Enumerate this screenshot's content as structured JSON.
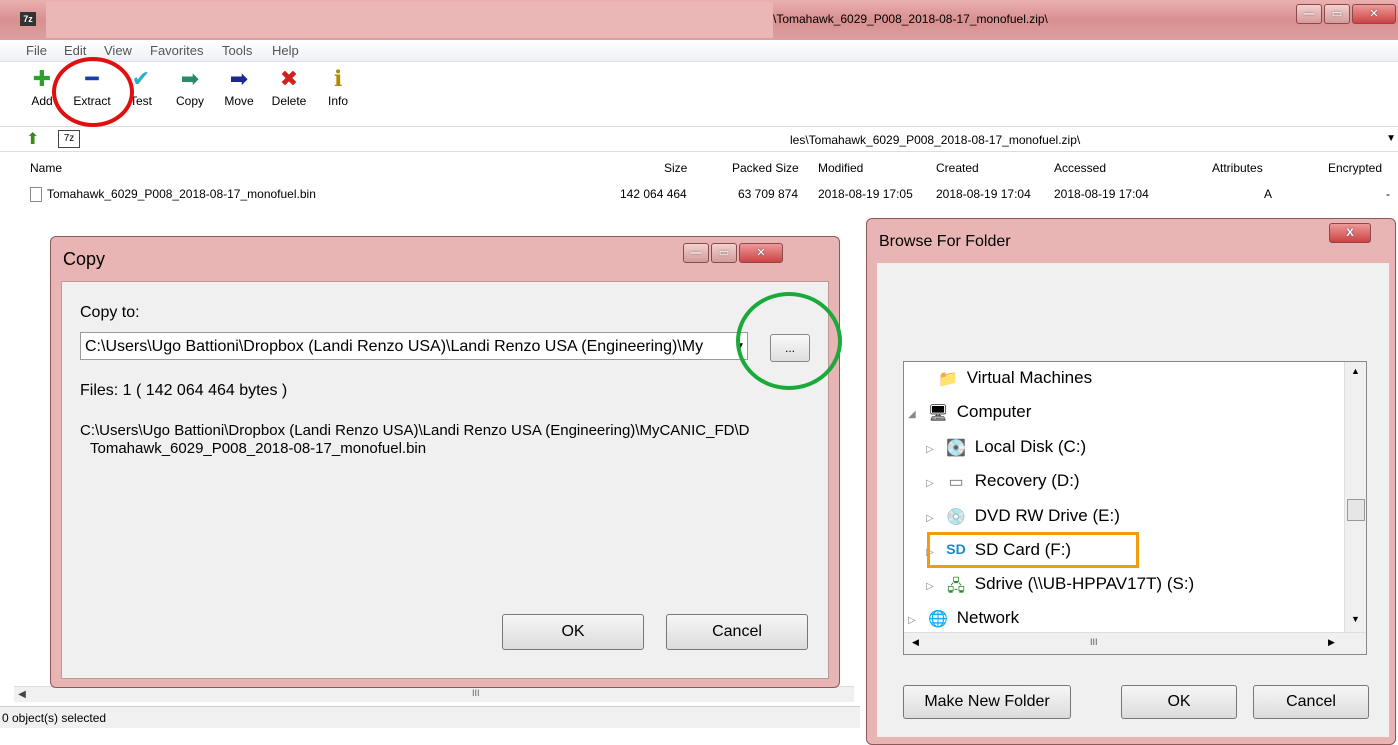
{
  "main": {
    "title_path": "\\Tomahawk_6029_P008_2018-08-17_monofuel.zip\\",
    "app_icon": "7z",
    "menu": [
      "File",
      "Edit",
      "View",
      "Favorites",
      "Tools",
      "Help"
    ],
    "toolbar": [
      {
        "label": "Add",
        "icon": "plus-icon",
        "glyph": "✚",
        "color": "#2ea02e"
      },
      {
        "label": "Extract",
        "icon": "minus-icon",
        "glyph": "━",
        "color": "#1a3fa8"
      },
      {
        "label": "Test",
        "icon": "check-icon",
        "glyph": "✔",
        "color": "#2aaec8"
      },
      {
        "label": "Copy",
        "icon": "copy-arrow-icon",
        "glyph": "➡",
        "color": "#2a8a6a"
      },
      {
        "label": "Move",
        "icon": "move-arrow-icon",
        "glyph": "➡",
        "color": "#1a2a8a"
      },
      {
        "label": "Delete",
        "icon": "delete-icon",
        "glyph": "✖",
        "color": "#d02020"
      },
      {
        "label": "Info",
        "icon": "info-icon",
        "glyph": "ℹ",
        "color": "#b08a00"
      }
    ],
    "address": "les\\Tomahawk_6029_P008_2018-08-17_monofuel.zip\\",
    "columns": [
      "Name",
      "Size",
      "Packed Size",
      "Modified",
      "Created",
      "Accessed",
      "Attributes",
      "Encrypted"
    ],
    "file": {
      "name": "Tomahawk_6029_P008_2018-08-17_monofuel.bin",
      "size": "142 064 464",
      "packed": "63 709 874",
      "modified": "2018-08-19 17:05",
      "created": "2018-08-19 17:04",
      "accessed": "2018-08-19 17:04",
      "attributes": "A",
      "encrypted": "-"
    },
    "status": "0 object(s) selected",
    "scroll_marker": "III"
  },
  "copy_dialog": {
    "title": "Copy",
    "copy_to_label": "Copy to:",
    "path_value": "C:\\Users\\Ugo Battioni\\Dropbox (Landi Renzo USA)\\Landi Renzo USA (Engineering)\\My",
    "browse_label": "...",
    "files_info": "Files: 1    ( 142 064 464 bytes )",
    "dest_line1": "C:\\Users\\Ugo Battioni\\Dropbox (Landi Renzo USA)\\Landi Renzo USA (Engineering)\\MyCANIC_FD\\D",
    "dest_line2": "Tomahawk_6029_P008_2018-08-17_monofuel.bin",
    "ok": "OK",
    "cancel": "Cancel"
  },
  "browse_dialog": {
    "title": "Browse For Folder",
    "close": "X",
    "tree": [
      {
        "label": "Virtual Machines",
        "icon": "folder-icon",
        "glyph": "📁",
        "expander": ""
      },
      {
        "label": "Computer",
        "icon": "computer-icon",
        "glyph": "🖥",
        "expander": "◢"
      },
      {
        "label": "Local Disk (C:)",
        "icon": "local-disk-icon",
        "glyph": "💽",
        "expander": "▷"
      },
      {
        "label": "Recovery (D:)",
        "icon": "drive-icon",
        "glyph": "▭",
        "expander": "▷"
      },
      {
        "label": "DVD RW Drive (E:)",
        "icon": "dvd-drive-icon",
        "glyph": "💿",
        "expander": "▷"
      },
      {
        "label": "SD Card (F:)",
        "icon": "sd-card-icon",
        "glyph": "SD",
        "expander": "▷"
      },
      {
        "label": "Sdrive (\\\\UB-HPPAV17T) (S:)",
        "icon": "network-drive-icon",
        "glyph": "🖧",
        "expander": "▷"
      },
      {
        "label": "Network",
        "icon": "network-icon",
        "glyph": "🌐",
        "expander": "▷"
      }
    ],
    "scroll_marker": "III",
    "make_new_folder": "Make New Folder",
    "ok": "OK",
    "cancel": "Cancel"
  },
  "annotations": {
    "red_ring": "#e01010",
    "green_ring": "#1aaa3a",
    "orange_box": "#f39a10"
  }
}
